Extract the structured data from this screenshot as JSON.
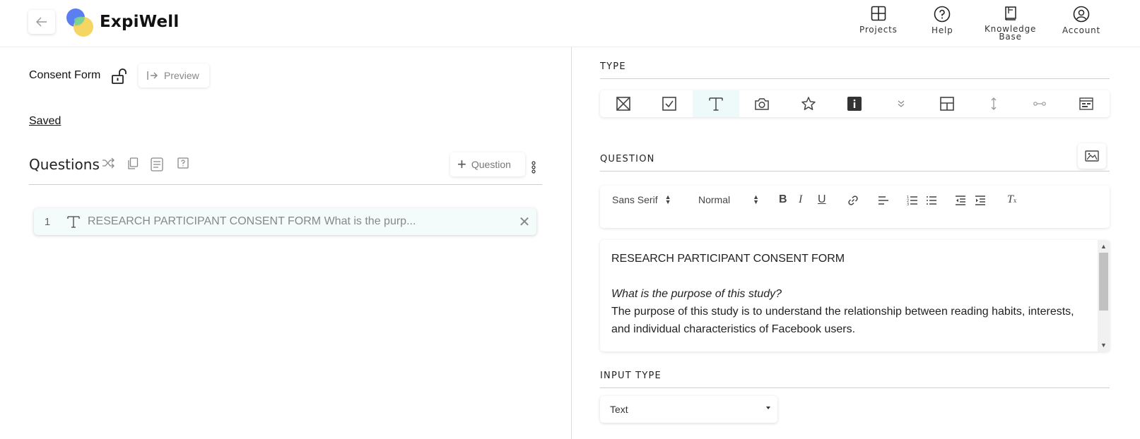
{
  "header": {
    "brand": "ExpiWell",
    "nav": [
      {
        "label": "Projects",
        "icon": "grid-icon"
      },
      {
        "label": "Help",
        "icon": "help-circle-icon"
      },
      {
        "label_line1": "Knowledge",
        "label_line2": "Base",
        "icon": "book-icon"
      },
      {
        "label": "Account",
        "icon": "user-circle-icon"
      }
    ]
  },
  "left": {
    "form_title": "Consent Form",
    "preview_label": "Preview",
    "saved_label": "Saved",
    "questions_title": "Questions",
    "add_question_label": "Question",
    "questions": [
      {
        "number": "1",
        "type_icon": "text-type-icon",
        "text": "RESEARCH PARTICIPANT CONSENT FORM What is the purp...",
        "close": "✕"
      }
    ]
  },
  "right": {
    "type_label": "TYPE",
    "question_label": "QUESTION",
    "input_type_label": "INPUT TYPE",
    "toolbar": {
      "font": "Sans Serif",
      "size": "Normal",
      "bold": "B",
      "italic": "I",
      "underline": "U",
      "clear": "T"
    },
    "editor": {
      "line1": "RESEARCH PARTICIPANT CONSENT FORM",
      "line2": "What is the purpose of this study?",
      "line3": "The purpose of this study is to understand the relationship between reading habits, interests, and individual characteristics of Facebook users."
    },
    "input_type_value": "Text"
  },
  "colors": {
    "active_type_bg": "#eefafa",
    "question_item_bg": "#f3fbfb",
    "logo_blue": "#5b7ff0",
    "logo_yellow": "#f6d45a",
    "logo_green": "#6fd29a"
  }
}
